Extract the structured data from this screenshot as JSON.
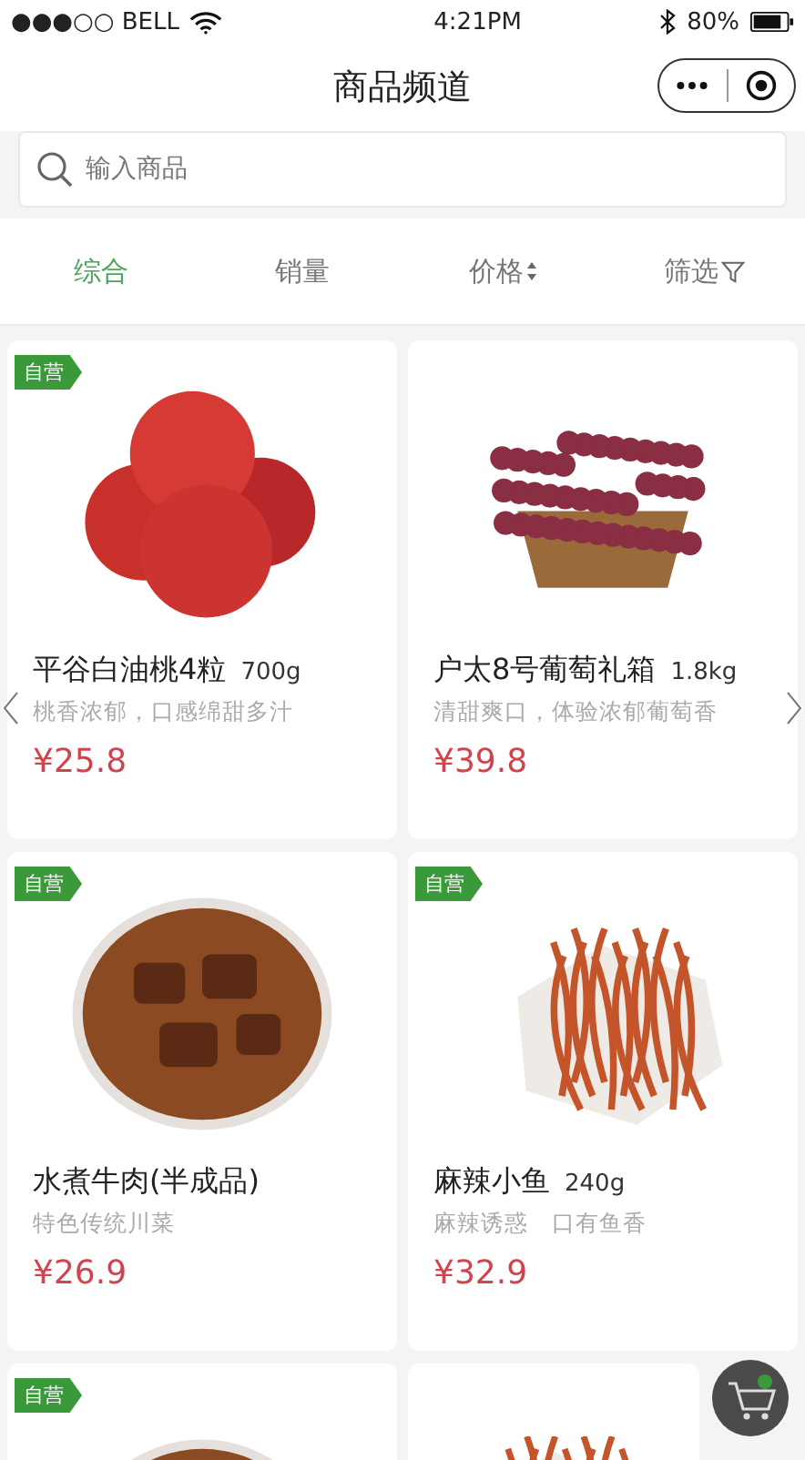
{
  "status_bar": {
    "carrier": "●●●○○ BELL",
    "time": "4:21PM",
    "battery": "80%"
  },
  "nav": {
    "title": "商品频道"
  },
  "search": {
    "placeholder": "输入商品"
  },
  "tabs": [
    {
      "label": "综合",
      "selected": true,
      "kind": "plain"
    },
    {
      "label": "销量",
      "selected": false,
      "kind": "plain"
    },
    {
      "label": "价格",
      "selected": false,
      "kind": "sort"
    },
    {
      "label": "筛选",
      "selected": false,
      "kind": "filter"
    }
  ],
  "products": [
    {
      "badge": "自营",
      "self_operated": true,
      "kind": "peach",
      "name": "平谷白油桃4粒",
      "weight": "700g",
      "desc": "桃香浓郁，口感绵甜多汁",
      "price": "¥25.8"
    },
    {
      "self_operated": false,
      "kind": "grape",
      "name": "户太8号葡萄礼箱",
      "weight": "1.8kg",
      "desc": "清甜爽口，体验浓郁葡萄香",
      "price": "¥39.8"
    },
    {
      "badge": "自营",
      "self_operated": true,
      "kind": "beef",
      "name": "水煮牛肉(半成品)",
      "desc": "特色传统川菜",
      "price": "¥26.9"
    },
    {
      "badge": "自营",
      "self_operated": true,
      "kind": "fish",
      "name": "麻辣小鱼",
      "weight": "240g",
      "desc": "麻辣诱惑　口有鱼香",
      "price": "¥32.9"
    },
    {
      "badge": "自营",
      "self_operated": true,
      "kind": "beef"
    },
    {
      "self_operated": false,
      "kind": "fish"
    }
  ]
}
